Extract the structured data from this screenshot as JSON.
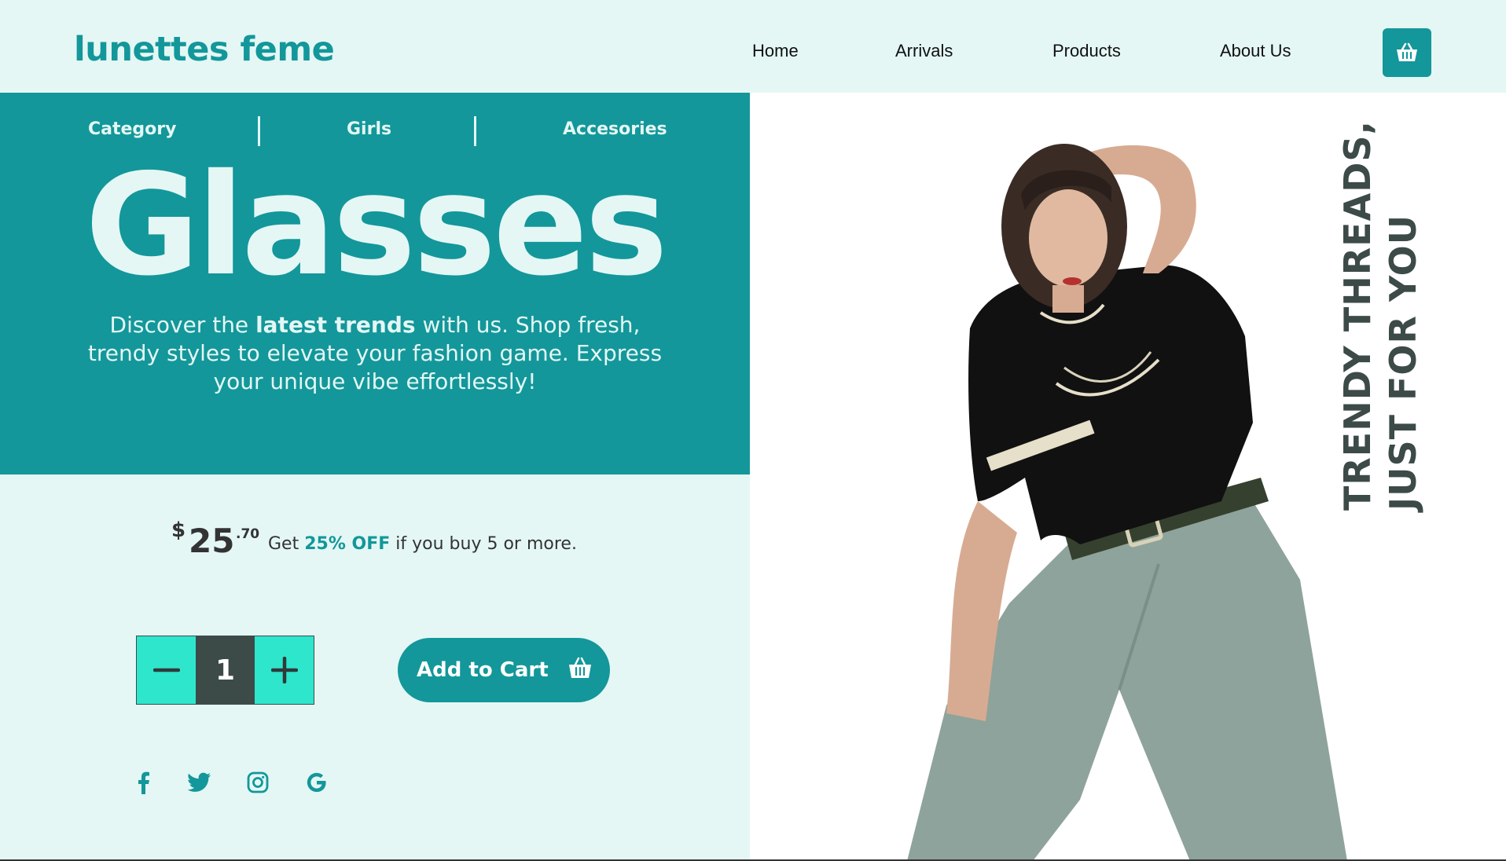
{
  "brand": {
    "logo": "lunettes feme"
  },
  "nav": {
    "items": [
      "Home",
      "Arrivals",
      "Products",
      "About Us"
    ],
    "cart_icon": "basket-icon"
  },
  "hero": {
    "categories": [
      "Category",
      "Girls",
      "Accesories"
    ],
    "title": "Glasses",
    "desc_pre": "Discover the ",
    "desc_bold": "latest trends",
    "desc_post": " with us. Shop fresh, trendy styles to elevate your fashion game. Express your unique vibe effortlessly!"
  },
  "product": {
    "currency": "$",
    "price_int": "25",
    "price_dec": ".70",
    "offer_pre": "Get ",
    "offer_highlight": "25% OFF",
    "offer_post": " if you buy 5 or more.",
    "quantity": "1",
    "add_to_cart": "Add to Cart"
  },
  "social": [
    "facebook-icon",
    "twitter-icon",
    "instagram-icon",
    "google-icon"
  ],
  "tagline": {
    "line1": "TRENDY THREADS,",
    "line2": "JUST FOR YOU"
  },
  "colors": {
    "teal": "#13979a",
    "mint_bg": "#e4f7f5",
    "aqua": "#2ee6cc",
    "dark": "#3c4a48"
  }
}
